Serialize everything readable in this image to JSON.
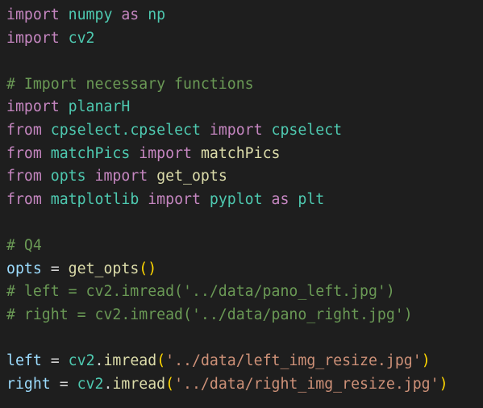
{
  "editor": {
    "language": "python",
    "colors": {
      "background": "#1e1e1e",
      "keyword": "#c586c0",
      "module": "#4ec9b0",
      "function": "#dcdcaa",
      "variable": "#9cdcfe",
      "operator": "#d4d4d4",
      "comment": "#6a9955",
      "string": "#ce9178",
      "bracket": "#ffd700"
    },
    "lines": [
      [
        {
          "t": "import",
          "c": "kw"
        },
        {
          "t": " ",
          "c": "op"
        },
        {
          "t": "numpy",
          "c": "mod"
        },
        {
          "t": " ",
          "c": "op"
        },
        {
          "t": "as",
          "c": "kw"
        },
        {
          "t": " ",
          "c": "op"
        },
        {
          "t": "np",
          "c": "mod"
        }
      ],
      [
        {
          "t": "import",
          "c": "kw"
        },
        {
          "t": " ",
          "c": "op"
        },
        {
          "t": "cv2",
          "c": "mod"
        }
      ],
      [],
      [
        {
          "t": "# Import necessary functions",
          "c": "com"
        }
      ],
      [
        {
          "t": "import",
          "c": "kw"
        },
        {
          "t": " ",
          "c": "op"
        },
        {
          "t": "planarH",
          "c": "mod"
        }
      ],
      [
        {
          "t": "from",
          "c": "kw"
        },
        {
          "t": " ",
          "c": "op"
        },
        {
          "t": "cpselect.cpselect",
          "c": "mod"
        },
        {
          "t": " ",
          "c": "op"
        },
        {
          "t": "import",
          "c": "kw"
        },
        {
          "t": " ",
          "c": "op"
        },
        {
          "t": "cpselect",
          "c": "mod"
        }
      ],
      [
        {
          "t": "from",
          "c": "kw"
        },
        {
          "t": " ",
          "c": "op"
        },
        {
          "t": "matchPics",
          "c": "mod"
        },
        {
          "t": " ",
          "c": "op"
        },
        {
          "t": "import",
          "c": "kw"
        },
        {
          "t": " ",
          "c": "op"
        },
        {
          "t": "matchPics",
          "c": "fn"
        }
      ],
      [
        {
          "t": "from",
          "c": "kw"
        },
        {
          "t": " ",
          "c": "op"
        },
        {
          "t": "opts",
          "c": "mod"
        },
        {
          "t": " ",
          "c": "op"
        },
        {
          "t": "import",
          "c": "kw"
        },
        {
          "t": " ",
          "c": "op"
        },
        {
          "t": "get_opts",
          "c": "fn"
        }
      ],
      [
        {
          "t": "from",
          "c": "kw"
        },
        {
          "t": " ",
          "c": "op"
        },
        {
          "t": "matplotlib",
          "c": "mod"
        },
        {
          "t": " ",
          "c": "op"
        },
        {
          "t": "import",
          "c": "kw"
        },
        {
          "t": " ",
          "c": "op"
        },
        {
          "t": "pyplot",
          "c": "mod"
        },
        {
          "t": " ",
          "c": "op"
        },
        {
          "t": "as",
          "c": "kw"
        },
        {
          "t": " ",
          "c": "op"
        },
        {
          "t": "plt",
          "c": "mod"
        }
      ],
      [],
      [
        {
          "t": "# Q4",
          "c": "com"
        }
      ],
      [
        {
          "t": "opts",
          "c": "var"
        },
        {
          "t": " = ",
          "c": "op"
        },
        {
          "t": "get_opts",
          "c": "fn"
        },
        {
          "t": "()",
          "c": "paren"
        }
      ],
      [
        {
          "t": "# left = cv2.imread('../data/pano_left.jpg')",
          "c": "com"
        }
      ],
      [
        {
          "t": "# right = cv2.imread('../data/pano_right.jpg')",
          "c": "com"
        }
      ],
      [],
      [
        {
          "t": "left",
          "c": "var"
        },
        {
          "t": " = ",
          "c": "op"
        },
        {
          "t": "cv2",
          "c": "mod"
        },
        {
          "t": ".",
          "c": "op"
        },
        {
          "t": "imread",
          "c": "fn"
        },
        {
          "t": "(",
          "c": "paren"
        },
        {
          "t": "'../data/left_img_resize.jpg'",
          "c": "str"
        },
        {
          "t": ")",
          "c": "paren"
        }
      ],
      [
        {
          "t": "right",
          "c": "var"
        },
        {
          "t": " = ",
          "c": "op"
        },
        {
          "t": "cv2",
          "c": "mod"
        },
        {
          "t": ".",
          "c": "op"
        },
        {
          "t": "imread",
          "c": "fn"
        },
        {
          "t": "(",
          "c": "paren"
        },
        {
          "t": "'../data/right_img_resize.jpg'",
          "c": "str"
        },
        {
          "t": ")",
          "c": "paren"
        }
      ]
    ]
  }
}
